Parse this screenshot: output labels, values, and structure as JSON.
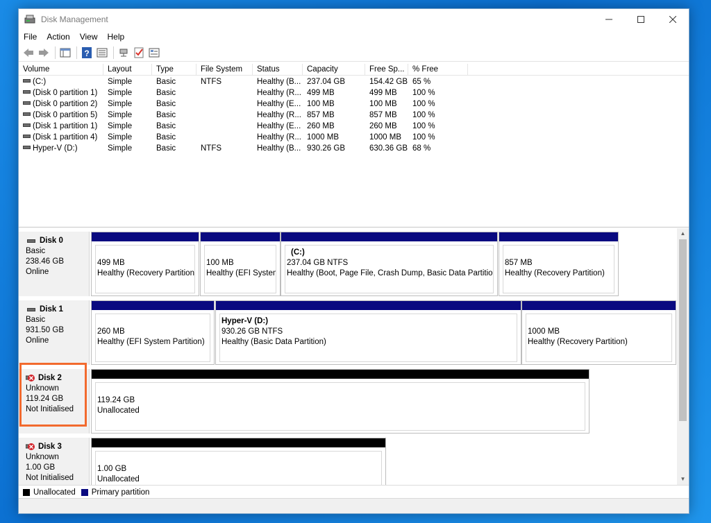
{
  "window": {
    "title": "Disk Management"
  },
  "menu": [
    {
      "label": "File"
    },
    {
      "label": "Action"
    },
    {
      "label": "View"
    },
    {
      "label": "Help"
    }
  ],
  "volumes": {
    "columns": [
      "Volume",
      "Layout",
      "Type",
      "File System",
      "Status",
      "Capacity",
      "Free Sp...",
      "% Free"
    ],
    "rows": [
      {
        "volume": "(C:)",
        "layout": "Simple",
        "type": "Basic",
        "fs": "NTFS",
        "status": "Healthy (B...",
        "capacity": "237.04 GB",
        "free": "154.42 GB",
        "pct": "65 %"
      },
      {
        "volume": "(Disk 0 partition 1)",
        "layout": "Simple",
        "type": "Basic",
        "fs": "",
        "status": "Healthy (R...",
        "capacity": "499 MB",
        "free": "499 MB",
        "pct": "100 %"
      },
      {
        "volume": "(Disk 0 partition 2)",
        "layout": "Simple",
        "type": "Basic",
        "fs": "",
        "status": "Healthy (E...",
        "capacity": "100 MB",
        "free": "100 MB",
        "pct": "100 %"
      },
      {
        "volume": "(Disk 0 partition 5)",
        "layout": "Simple",
        "type": "Basic",
        "fs": "",
        "status": "Healthy (R...",
        "capacity": "857 MB",
        "free": "857 MB",
        "pct": "100 %"
      },
      {
        "volume": "(Disk 1 partition 1)",
        "layout": "Simple",
        "type": "Basic",
        "fs": "",
        "status": "Healthy (E...",
        "capacity": "260 MB",
        "free": "260 MB",
        "pct": "100 %"
      },
      {
        "volume": "(Disk 1 partition 4)",
        "layout": "Simple",
        "type": "Basic",
        "fs": "",
        "status": "Healthy (R...",
        "capacity": "1000 MB",
        "free": "1000 MB",
        "pct": "100 %"
      },
      {
        "volume": "Hyper-V (D:)",
        "layout": "Simple",
        "type": "Basic",
        "fs": "NTFS",
        "status": "Healthy (B...",
        "capacity": "930.26 GB",
        "free": "630.36 GB",
        "pct": "68 %"
      }
    ]
  },
  "disks": [
    {
      "name": "Disk 0",
      "type": "Basic",
      "size": "238.46 GB",
      "state": "Online",
      "partitions": [
        {
          "title": "",
          "line1": "499 MB",
          "line2": "Healthy (Recovery Partition)"
        },
        {
          "title": "",
          "line1": "100 MB",
          "line2": "Healthy (EFI System"
        },
        {
          "title": "(C:)",
          "line1": "237.04 GB NTFS",
          "line2": "Healthy (Boot, Page File, Crash Dump, Basic Data Partition)"
        },
        {
          "title": "",
          "line1": "857 MB",
          "line2": "Healthy (Recovery Partition)"
        }
      ]
    },
    {
      "name": "Disk 1",
      "type": "Basic",
      "size": "931.50 GB",
      "state": "Online",
      "partitions": [
        {
          "title": "",
          "line1": "260 MB",
          "line2": "Healthy (EFI System Partition)"
        },
        {
          "title": "Hyper-V  (D:)",
          "line1": "930.26 GB NTFS",
          "line2": "Healthy (Basic Data Partition)"
        },
        {
          "title": "",
          "line1": "1000 MB",
          "line2": "Healthy (Recovery Partition)"
        }
      ]
    },
    {
      "name": "Disk 2",
      "type": "Unknown",
      "size": "119.24 GB",
      "state": "Not Initialised",
      "partitions": [
        {
          "title": "",
          "line1": "119.24 GB",
          "line2": "Unallocated"
        }
      ]
    },
    {
      "name": "Disk 3",
      "type": "Unknown",
      "size": "1.00 GB",
      "state": "Not Initialised",
      "partitions": [
        {
          "title": "",
          "line1": "1.00 GB",
          "line2": "Unallocated"
        }
      ]
    }
  ],
  "legend": {
    "unallocated": "Unallocated",
    "primary": "Primary partition"
  },
  "colors": {
    "primary": "#0a0a80",
    "unallocated": "#000000",
    "highlight": "#f26a2e"
  },
  "icons": [
    "disk-management-app-icon",
    "back-arrow-icon",
    "forward-arrow-icon",
    "console-tree-icon",
    "help-icon",
    "properties-icon",
    "connect-icon",
    "checklist-icon",
    "details-icon",
    "drive-icon",
    "disk-error-icon"
  ]
}
